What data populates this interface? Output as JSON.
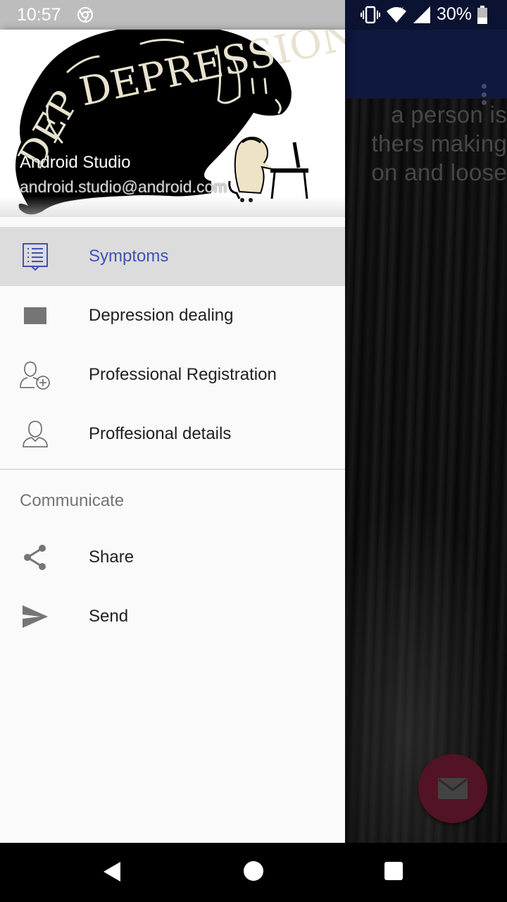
{
  "status_bar": {
    "time": "10:57",
    "battery": "30%"
  },
  "background": {
    "text_lines": [
      "a person is",
      "thers  making",
      "on and loose"
    ]
  },
  "drawer": {
    "header": {
      "logo_text": "DEPRESSION",
      "user_name": "Android Studio",
      "user_email": "android.studio@android.com"
    },
    "items": [
      {
        "label": "Symptoms",
        "icon": "list-icon",
        "selected": true
      },
      {
        "label": "Depression dealing",
        "icon": "square-icon",
        "selected": false
      },
      {
        "label": "Professional Registration",
        "icon": "add-person-icon",
        "selected": false
      },
      {
        "label": "Proffesional details",
        "icon": "person-icon",
        "selected": false
      }
    ],
    "section": {
      "title": "Communicate",
      "items": [
        {
          "label": "Share",
          "icon": "share-icon"
        },
        {
          "label": "Send",
          "icon": "send-icon"
        }
      ]
    }
  },
  "colors": {
    "app_bar": "#152155",
    "accent": "#3f51b5",
    "fab": "#6e1a30"
  }
}
